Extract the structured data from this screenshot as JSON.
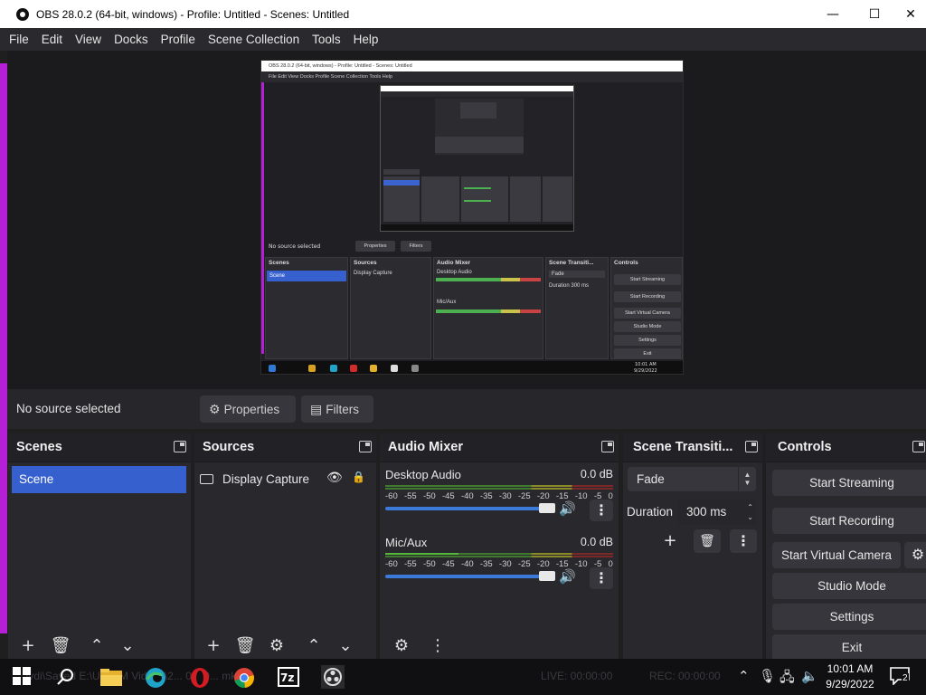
{
  "window": {
    "title": "OBS 28.0.2 (64-bit, windows) - Profile: Untitled - Scenes: Untitled",
    "minimize_glyph": "—",
    "maximize_glyph": "☐",
    "close_glyph": "✕"
  },
  "menu": [
    "File",
    "Edit",
    "View",
    "Docks",
    "Profile",
    "Scene Collection",
    "Tools",
    "Help"
  ],
  "preview": {
    "title": "OBS 28.0.2 (64-bit, windows) - Profile: Untitled - Scenes: Untitled",
    "menu": "File   Edit   View   Docks   Profile   Scene Collection   Tools   Help",
    "no_source": "No source selected",
    "properties": "Properties",
    "filters": "Filters",
    "scenes": "Scenes",
    "scene": "Scene",
    "sources": "Sources",
    "display_capture": "Display Capture",
    "audio_mixer": "Audio Mixer",
    "desktop_audio": "Desktop Audio",
    "mic_aux": "Mic/Aux",
    "db": "0.0 dB",
    "transitions": "Scene Transiti...",
    "fade": "Fade",
    "duration": "Duration",
    "duration_value": "300 ms",
    "controls": "Controls",
    "start_streaming": "Start Streaming",
    "start_recording": "Start Recording",
    "start_virtual_camera": "Start Virtual Camera",
    "studio_mode": "Studio Mode",
    "settings": "Settings",
    "exit": "Exit",
    "time": "10:01 AM",
    "date": "9/29/2022"
  },
  "properties_bar": {
    "no_source": "No source selected",
    "properties_label": "Properties",
    "filters_label": "Filters"
  },
  "scenes": {
    "title": "Scenes",
    "items": [
      "Scene"
    ]
  },
  "sources": {
    "title": "Sources",
    "items": [
      {
        "name": "Display Capture",
        "visible": true,
        "locked": false
      }
    ]
  },
  "mixer": {
    "title": "Audio Mixer",
    "scale": [
      "-60",
      "-55",
      "-50",
      "-45",
      "-40",
      "-35",
      "-30",
      "-25",
      "-20",
      "-15",
      "-10",
      "-5",
      "0"
    ],
    "tracks": [
      {
        "name": "Desktop Audio",
        "db": "0.0 dB"
      },
      {
        "name": "Mic/Aux",
        "db": "0.0 dB"
      }
    ]
  },
  "transitions": {
    "title": "Scene Transiti...",
    "selected": "Fade",
    "duration_label": "Duration",
    "duration_value": "300 ms"
  },
  "controls": {
    "title": "Controls",
    "start_streaming": "Start Streaming",
    "start_recording": "Start Recording",
    "start_virtual_camera": "Start Virtual Camera",
    "studio_mode": "Studio Mode",
    "settings": "Settings",
    "exit": "Exit"
  },
  "taskbar": {
    "ghost_text": "\\vdi\\Saved E:\\U... VM Videos\\2... 0... 0... mkv",
    "live": "LIVE: 00:00:00",
    "rec": "REC: 00:00:00",
    "time": "10:01 AM",
    "date": "9/29/2022",
    "notifications": "2"
  },
  "colors": {
    "accent": "#3760cf",
    "dock_bg": "#29292d",
    "magenta_border": "#b51fd6"
  }
}
